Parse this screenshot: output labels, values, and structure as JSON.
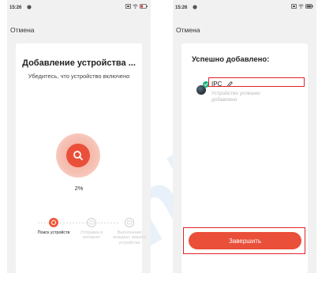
{
  "colors": {
    "accent": "#ea4f3a",
    "highlight_outline": "#e2232a",
    "success": "#21b27b",
    "screen_background": "#f1f1f1"
  },
  "status_bar": {
    "left_time": "15:26",
    "right_time": "15:26",
    "icons": [
      "sim-icon",
      "wifi-icon",
      "battery-icon"
    ]
  },
  "left_screen": {
    "cancel_label": "Отмена",
    "title": "Добавление устройства ...",
    "subtitle": "Убедитесь, что устройство включено",
    "progress_percent": 2,
    "progress_text": "2%",
    "steps": [
      {
        "label": "Поиск устройств",
        "active": true
      },
      {
        "label": "Отправка в интернет",
        "active": false
      },
      {
        "label": "Выполнение инициал. вашего устройства",
        "active": false
      }
    ]
  },
  "right_screen": {
    "cancel_label": "Отмена",
    "title": "Успешно добавлено:",
    "device": {
      "name": "IPC",
      "status": "Устройство успешно добавлено"
    },
    "finish_label": "Завершить"
  },
  "watermark_text": "link"
}
